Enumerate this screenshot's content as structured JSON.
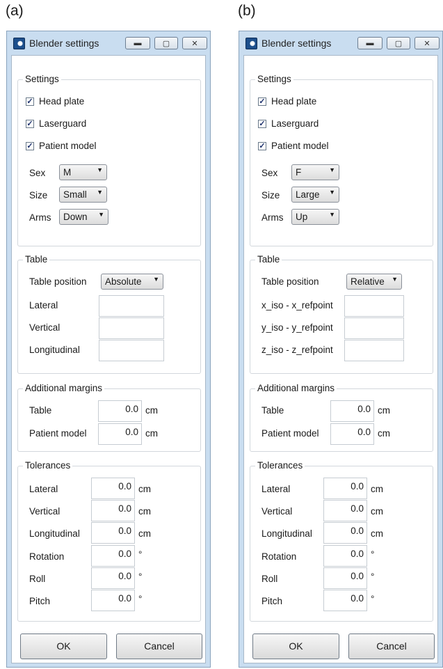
{
  "panels": [
    {
      "letter": "(a)",
      "title": "Blender settings",
      "settings": {
        "title": "Settings",
        "checks": [
          {
            "label": "Head plate",
            "checked": true
          },
          {
            "label": "Laserguard",
            "checked": true
          },
          {
            "label": "Patient model",
            "checked": true
          }
        ],
        "combos": [
          {
            "label": "Sex",
            "value": "M"
          },
          {
            "label": "Size",
            "value": "Small"
          },
          {
            "label": "Arms",
            "value": "Down"
          }
        ]
      },
      "table": {
        "title": "Table",
        "position_label": "Table position",
        "position_value": "Absolute",
        "fields": [
          {
            "label": "Lateral",
            "value": ""
          },
          {
            "label": "Vertical",
            "value": ""
          },
          {
            "label": "Longitudinal",
            "value": ""
          }
        ]
      },
      "margins": {
        "title": "Additional margins",
        "fields": [
          {
            "label": "Table",
            "value": "0.0",
            "unit": "cm"
          },
          {
            "label": "Patient model",
            "value": "0.0",
            "unit": "cm"
          }
        ]
      },
      "tolerances": {
        "title": "Tolerances",
        "fields": [
          {
            "label": "Lateral",
            "value": "0.0",
            "unit": "cm"
          },
          {
            "label": "Vertical",
            "value": "0.0",
            "unit": "cm"
          },
          {
            "label": "Longitudinal",
            "value": "0.0",
            "unit": "cm"
          },
          {
            "label": "Rotation",
            "value": "0.0",
            "unit": "°"
          },
          {
            "label": "Roll",
            "value": "0.0",
            "unit": "°"
          },
          {
            "label": "Pitch",
            "value": "0.0",
            "unit": "°"
          }
        ]
      },
      "ok_label": "OK",
      "cancel_label": "Cancel"
    },
    {
      "letter": "(b)",
      "title": "Blender settings",
      "settings": {
        "title": "Settings",
        "checks": [
          {
            "label": "Head plate",
            "checked": true
          },
          {
            "label": "Laserguard",
            "checked": true
          },
          {
            "label": "Patient model",
            "checked": true
          }
        ],
        "combos": [
          {
            "label": "Sex",
            "value": "F"
          },
          {
            "label": "Size",
            "value": "Large"
          },
          {
            "label": "Arms",
            "value": "Up"
          }
        ]
      },
      "table": {
        "title": "Table",
        "position_label": "Table position",
        "position_value": "Relative",
        "fields": [
          {
            "label": "x_iso - x_refpoint",
            "value": ""
          },
          {
            "label": "y_iso - y_refpoint",
            "value": ""
          },
          {
            "label": "z_iso - z_refpoint",
            "value": ""
          }
        ]
      },
      "margins": {
        "title": "Additional margins",
        "fields": [
          {
            "label": "Table",
            "value": "0.0",
            "unit": "cm"
          },
          {
            "label": "Patient model",
            "value": "0.0",
            "unit": "cm"
          }
        ]
      },
      "tolerances": {
        "title": "Tolerances",
        "fields": [
          {
            "label": "Lateral",
            "value": "0.0",
            "unit": "cm"
          },
          {
            "label": "Vertical",
            "value": "0.0",
            "unit": "cm"
          },
          {
            "label": "Longitudinal",
            "value": "0.0",
            "unit": "cm"
          },
          {
            "label": "Rotation",
            "value": "0.0",
            "unit": "°"
          },
          {
            "label": "Roll",
            "value": "0.0",
            "unit": "°"
          },
          {
            "label": "Pitch",
            "value": "0.0",
            "unit": "°"
          }
        ]
      },
      "ok_label": "OK",
      "cancel_label": "Cancel"
    }
  ],
  "colors": {
    "titlebar": "#c9ddf0",
    "content": "#ffffff",
    "check": "#1b2f6b"
  },
  "icons": {
    "minimize": "minimize-icon",
    "maximize": "maximize-icon",
    "close": "close-icon",
    "app": "blender-app-icon",
    "check": "checkmark-icon",
    "dropdown": "chevron-down-icon"
  }
}
